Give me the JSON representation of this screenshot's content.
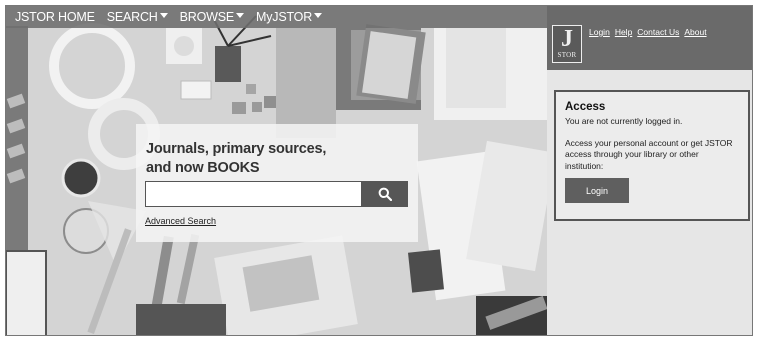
{
  "nav": {
    "home": "JSTOR HOME",
    "search": "SEARCH",
    "browse": "BROWSE",
    "myjstor": "MyJSTOR"
  },
  "utility_links": [
    "Login",
    "Help",
    "Contact Us",
    "About"
  ],
  "logo": {
    "letter": "J",
    "wordmark": "STOR"
  },
  "hero": {
    "headline_line1": "Journals, primary sources,",
    "headline_line2": "and now BOOKS",
    "search_value": "",
    "advanced_search": "Advanced Search"
  },
  "access": {
    "title": "Access",
    "status": "You are not currently logged in.",
    "description": "Access your personal account or get JSTOR access through your library or other institution:",
    "login_button": "Login"
  },
  "icons": [
    "search-icon",
    "caret-down-icon",
    "jstor-logo"
  ],
  "colors": {
    "nav_bar": "#6e6e6e",
    "button": "#565656",
    "panel": "#e6e6e6"
  }
}
